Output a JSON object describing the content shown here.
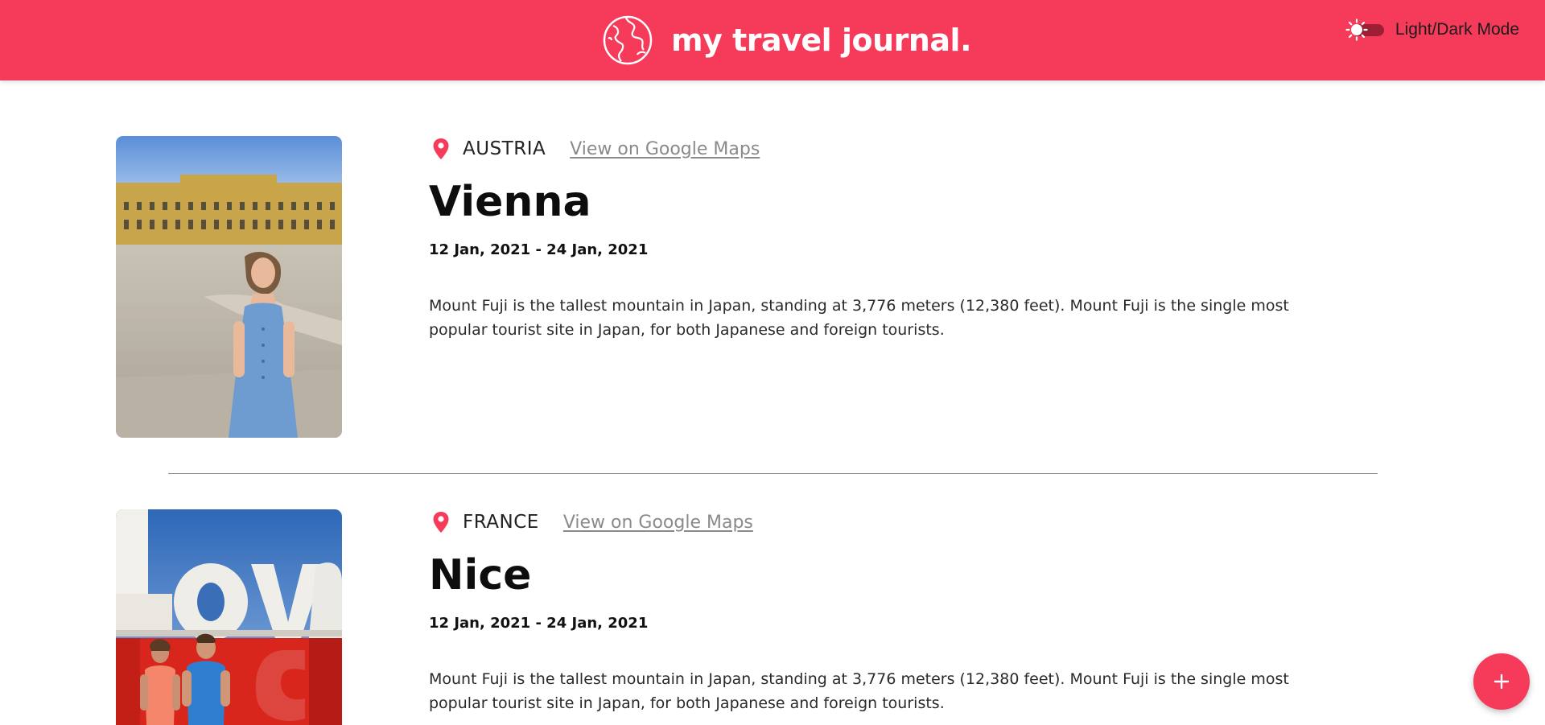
{
  "header": {
    "title": "my travel journal.",
    "mode_label": "Light/Dark Mode",
    "brand_color": "#f63a5a"
  },
  "entries": [
    {
      "country": "AUSTRIA",
      "maps_link": "View on Google Maps",
      "city": "Vienna",
      "dates": "12 Jan, 2021 - 24 Jan, 2021",
      "description": "Mount Fuji is the tallest mountain in Japan, standing at 3,776 meters (12,380 feet). Mount Fuji is the single most popular tourist site in Japan, for both Japanese and foreign tourists."
    },
    {
      "country": "FRANCE",
      "maps_link": "View on Google Maps",
      "city": "Nice",
      "dates": "12 Jan, 2021 - 24 Jan, 2021",
      "description": "Mount Fuji is the tallest mountain in Japan, standing at 3,776 meters (12,380 feet). Mount Fuji is the single most popular tourist site in Japan, for both Japanese and foreign tourists."
    }
  ],
  "icons": {
    "logo": "globe-icon",
    "mode": "sun-icon",
    "location": "map-pin-icon",
    "add": "plus-icon"
  }
}
